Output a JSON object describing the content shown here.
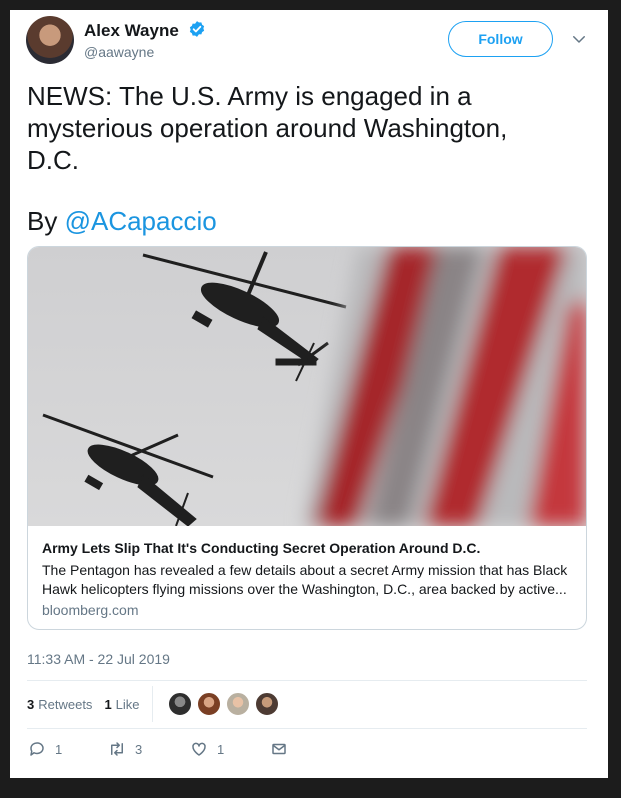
{
  "author": {
    "name": "Alex Wayne",
    "handle": "@aawayne",
    "verified": true
  },
  "header": {
    "follow_label": "Follow",
    "menu_icon": "chevron-down-icon"
  },
  "tweet": {
    "text": "NEWS: The U.S. Army is engaged in a\nmysterious operation around Washington,\nD.C.",
    "by_prefix": "By ",
    "mention": "@ACapaccio",
    "timestamp": "11:33 AM - 22 Jul 2019"
  },
  "link_card": {
    "image": "photo of two attack helicopters flying with a blurred American flag in foreground",
    "title": "Army Lets Slip That It's Conducting Secret Operation Around D.C.",
    "description": "The Pentagon has revealed a few details about a secret Army mission that has Black Hawk helicopters flying missions over the Washington, D.C., area backed by active...",
    "domain": "bloomberg.com"
  },
  "stats": {
    "retweets_count": "3",
    "retweets_label": "Retweets",
    "likes_count": "1",
    "likes_label": "Like"
  },
  "actions": {
    "reply_count": "1",
    "retweet_count": "3",
    "like_count": "1"
  },
  "colors": {
    "accent": "#1da1f2",
    "mention": "#1b95e0",
    "muted": "#657786",
    "border": "#ccd6dd"
  }
}
